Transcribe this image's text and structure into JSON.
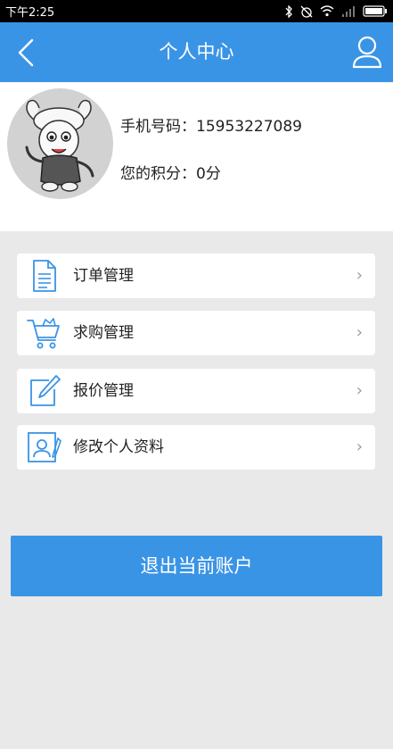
{
  "status_bar": {
    "time": "下午2:25"
  },
  "navbar": {
    "title": "个人中心",
    "back_icon": "chevron-left-icon",
    "user_icon": "user-icon"
  },
  "profile": {
    "phone": "手机号码：15953227089",
    "points": "您的积分：0分"
  },
  "menu": {
    "items": [
      {
        "label": "订单管理",
        "icon": "document-icon"
      },
      {
        "label": "求购管理",
        "icon": "shopping-cart-icon"
      },
      {
        "label": "报价管理",
        "icon": "edit-icon"
      },
      {
        "label": "修改个人资料",
        "icon": "profile-card-icon"
      }
    ],
    "arrow": "›"
  },
  "logout_label": "退出当前账户",
  "colors": {
    "accent": "#3a94e6",
    "background": "#e9e9e9"
  }
}
